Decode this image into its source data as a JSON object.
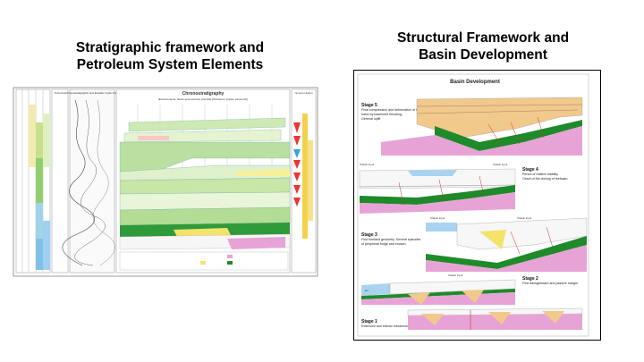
{
  "left_panel": {
    "title_lines": [
      "Stratigraphic framework and",
      "Petroleum System Elements"
    ],
    "chart_title": "Chronostratigraphy",
    "chart_subtitle": "(Environments, facies and resource potential (Petroleum system elements))",
    "col_tectonics": "Tectonics",
    "col_cycle": "Chronostratigraphic and Eustatic Cycle Chart",
    "col_history": "Source History"
  },
  "right_panel": {
    "title_lines": [
      "Structural Framework and",
      "Basin Development"
    ],
    "header": "Basin Development",
    "stages": [
      {
        "label": "Stage 5",
        "desc": [
          "Final compression and deformation of the",
          "basin by basement thrusting.",
          "General uplift"
        ]
      },
      {
        "label": "Stage 4",
        "desc": [
          "Period of relative stability",
          "Onset of the closing of thebasin."
        ]
      },
      {
        "label": "Stage 3",
        "desc": [
          "First foreland geometry. Several episodes",
          "of peripheral bulge and erosion."
        ]
      },
      {
        "label": "Stage 2",
        "desc": [
          "First transgression and passive margin"
        ]
      },
      {
        "label": "Stage 1",
        "desc": [
          "Extension and interior volcanism."
        ]
      }
    ],
    "clastic_input": "Clastic input",
    "km_marker": "km"
  },
  "colors": {
    "pink": "#e8a3d6",
    "green": "#1f8a2a",
    "orange": "#f2c98c",
    "blue": "#a9d3f0",
    "yellow": "#f3e36b",
    "lightgreen": "#bfe3a6"
  }
}
